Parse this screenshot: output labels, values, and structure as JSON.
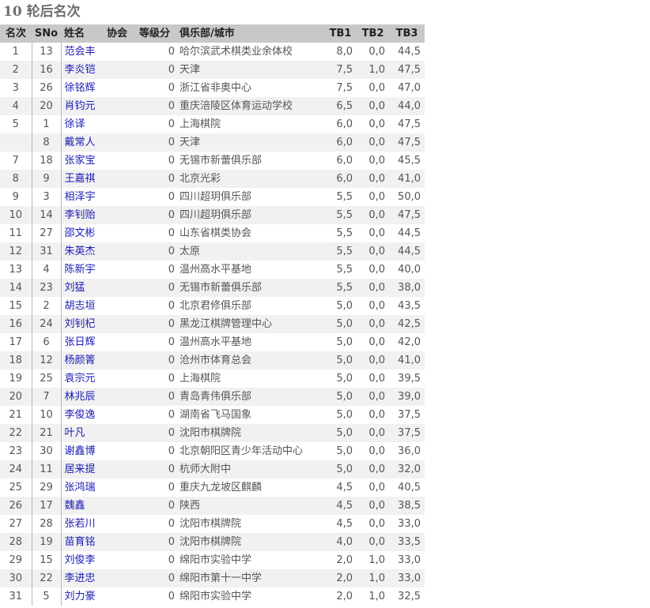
{
  "title": "10 轮后名次",
  "headers": {
    "rank": "名次",
    "sno": "SNo",
    "name": "姓名",
    "fed": "协会",
    "rating": "等级分",
    "club": "俱乐部/城市",
    "tb1": "TB1",
    "tb2": "TB2",
    "tb3": "TB3"
  },
  "rows": [
    {
      "rank": "1",
      "sno": "13",
      "name": "范会丰",
      "fed": "",
      "rating": "0",
      "club": "哈尔滨武术棋类业余体校",
      "tb1": "8,0",
      "tb2": "0,0",
      "tb3": "44,5"
    },
    {
      "rank": "2",
      "sno": "16",
      "name": "李炎铠",
      "fed": "",
      "rating": "0",
      "club": "天津",
      "tb1": "7,5",
      "tb2": "1,0",
      "tb3": "47,5"
    },
    {
      "rank": "3",
      "sno": "26",
      "name": "徐铭辉",
      "fed": "",
      "rating": "0",
      "club": "浙江省非奥中心",
      "tb1": "7,5",
      "tb2": "0,0",
      "tb3": "47,0"
    },
    {
      "rank": "4",
      "sno": "20",
      "name": "肖钧元",
      "fed": "",
      "rating": "0",
      "club": "重庆涪陵区体育运动学校",
      "tb1": "6,5",
      "tb2": "0,0",
      "tb3": "44,0"
    },
    {
      "rank": "5",
      "sno": "1",
      "name": "徐译",
      "fed": "",
      "rating": "0",
      "club": "上海棋院",
      "tb1": "6,0",
      "tb2": "0,0",
      "tb3": "47,5"
    },
    {
      "rank": "",
      "sno": "8",
      "name": "戴常人",
      "fed": "",
      "rating": "0",
      "club": "天津",
      "tb1": "6,0",
      "tb2": "0,0",
      "tb3": "47,5"
    },
    {
      "rank": "7",
      "sno": "18",
      "name": "张家宝",
      "fed": "",
      "rating": "0",
      "club": "无锡市新蕾俱乐部",
      "tb1": "6,0",
      "tb2": "0,0",
      "tb3": "45,5"
    },
    {
      "rank": "8",
      "sno": "9",
      "name": "王嘉祺",
      "fed": "",
      "rating": "0",
      "club": "北京光彩",
      "tb1": "6,0",
      "tb2": "0,0",
      "tb3": "41,0"
    },
    {
      "rank": "9",
      "sno": "3",
      "name": "相泽宇",
      "fed": "",
      "rating": "0",
      "club": "四川超玥俱乐部",
      "tb1": "5,5",
      "tb2": "0,0",
      "tb3": "50,0"
    },
    {
      "rank": "10",
      "sno": "14",
      "name": "李钊贻",
      "fed": "",
      "rating": "0",
      "club": "四川超玥俱乐部",
      "tb1": "5,5",
      "tb2": "0,0",
      "tb3": "47,5"
    },
    {
      "rank": "11",
      "sno": "27",
      "name": "邵文彬",
      "fed": "",
      "rating": "0",
      "club": "山东省棋类协会",
      "tb1": "5,5",
      "tb2": "0,0",
      "tb3": "44,5"
    },
    {
      "rank": "12",
      "sno": "31",
      "name": "朱英杰",
      "fed": "",
      "rating": "0",
      "club": "太原",
      "tb1": "5,5",
      "tb2": "0,0",
      "tb3": "44,5"
    },
    {
      "rank": "13",
      "sno": "4",
      "name": "陈新宇",
      "fed": "",
      "rating": "0",
      "club": "温州高水平基地",
      "tb1": "5,5",
      "tb2": "0,0",
      "tb3": "40,0"
    },
    {
      "rank": "14",
      "sno": "23",
      "name": "刘猛",
      "fed": "",
      "rating": "0",
      "club": "无锡市新蕾俱乐部",
      "tb1": "5,5",
      "tb2": "0,0",
      "tb3": "38,0"
    },
    {
      "rank": "15",
      "sno": "2",
      "name": "胡志垣",
      "fed": "",
      "rating": "0",
      "club": "北京君修俱乐部",
      "tb1": "5,0",
      "tb2": "0,0",
      "tb3": "43,5"
    },
    {
      "rank": "16",
      "sno": "24",
      "name": "刘钊杞",
      "fed": "",
      "rating": "0",
      "club": "黑龙江棋牌管理中心",
      "tb1": "5,0",
      "tb2": "0,0",
      "tb3": "42,5"
    },
    {
      "rank": "17",
      "sno": "6",
      "name": "张日辉",
      "fed": "",
      "rating": "0",
      "club": "温州高水平基地",
      "tb1": "5,0",
      "tb2": "0,0",
      "tb3": "42,0"
    },
    {
      "rank": "18",
      "sno": "12",
      "name": "杨颜箐",
      "fed": "",
      "rating": "0",
      "club": "沧州市体育总会",
      "tb1": "5,0",
      "tb2": "0,0",
      "tb3": "41,0"
    },
    {
      "rank": "19",
      "sno": "25",
      "name": "袁宗元",
      "fed": "",
      "rating": "0",
      "club": "上海棋院",
      "tb1": "5,0",
      "tb2": "0,0",
      "tb3": "39,5"
    },
    {
      "rank": "20",
      "sno": "7",
      "name": "林兆辰",
      "fed": "",
      "rating": "0",
      "club": "青岛青伟俱乐部",
      "tb1": "5,0",
      "tb2": "0,0",
      "tb3": "39,0"
    },
    {
      "rank": "21",
      "sno": "10",
      "name": "李俊逸",
      "fed": "",
      "rating": "0",
      "club": "湖南省飞马国象",
      "tb1": "5,0",
      "tb2": "0,0",
      "tb3": "37,5"
    },
    {
      "rank": "22",
      "sno": "21",
      "name": "叶凡",
      "fed": "",
      "rating": "0",
      "club": "沈阳市棋牌院",
      "tb1": "5,0",
      "tb2": "0,0",
      "tb3": "37,5"
    },
    {
      "rank": "23",
      "sno": "30",
      "name": "谢鑫博",
      "fed": "",
      "rating": "0",
      "club": "北京朝阳区青少年活动中心",
      "tb1": "5,0",
      "tb2": "0,0",
      "tb3": "36,0"
    },
    {
      "rank": "24",
      "sno": "11",
      "name": "居来提",
      "fed": "",
      "rating": "0",
      "club": "杭师大附中",
      "tb1": "5,0",
      "tb2": "0,0",
      "tb3": "32,0"
    },
    {
      "rank": "25",
      "sno": "29",
      "name": "张鸿瑞",
      "fed": "",
      "rating": "0",
      "club": "重庆九龙坡区麒麟",
      "tb1": "4,5",
      "tb2": "0,0",
      "tb3": "40,5"
    },
    {
      "rank": "26",
      "sno": "17",
      "name": "魏鑫",
      "fed": "",
      "rating": "0",
      "club": "陕西",
      "tb1": "4,5",
      "tb2": "0,0",
      "tb3": "38,5"
    },
    {
      "rank": "27",
      "sno": "28",
      "name": "张若川",
      "fed": "",
      "rating": "0",
      "club": "沈阳市棋牌院",
      "tb1": "4,5",
      "tb2": "0,0",
      "tb3": "33,0"
    },
    {
      "rank": "28",
      "sno": "19",
      "name": "苗育铭",
      "fed": "",
      "rating": "0",
      "club": "沈阳市棋牌院",
      "tb1": "4,0",
      "tb2": "0,0",
      "tb3": "33,5"
    },
    {
      "rank": "29",
      "sno": "15",
      "name": "刘俊李",
      "fed": "",
      "rating": "0",
      "club": "绵阳市实验中学",
      "tb1": "2,0",
      "tb2": "1,0",
      "tb3": "33,0"
    },
    {
      "rank": "30",
      "sno": "22",
      "name": "李进忠",
      "fed": "",
      "rating": "0",
      "club": "绵阳市第十一中学",
      "tb1": "2,0",
      "tb2": "1,0",
      "tb3": "33,0"
    },
    {
      "rank": "31",
      "sno": "5",
      "name": "刘力豪",
      "fed": "",
      "rating": "0",
      "club": "绵阳市实验中学",
      "tb1": "2,0",
      "tb2": "1,0",
      "tb3": "32,5"
    }
  ]
}
